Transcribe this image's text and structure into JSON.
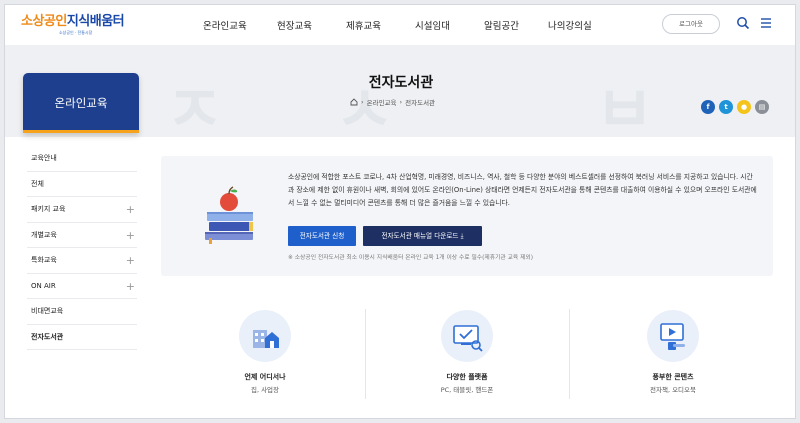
{
  "header": {
    "logo_primary": "소상공인",
    "logo_secondary": "지식배움터",
    "logo_tagline": "소상공인 · 전통시장",
    "nav": [
      "온라인교육",
      "현장교육",
      "제휴교육",
      "시설임대",
      "알림공간",
      "나의강의실"
    ],
    "login_label": "로그아웃"
  },
  "banner": {
    "title": "전자도서관",
    "breadcrumb": [
      "온라인교육",
      "전자도서관"
    ]
  },
  "sns": [
    {
      "icon": "facebook-icon",
      "glyph": "f",
      "color": "#1e63b8"
    },
    {
      "icon": "twitter-icon",
      "glyph": "t",
      "color": "#1f94d8"
    },
    {
      "icon": "kakao-story-icon",
      "glyph": "●",
      "color": "#f5c41a"
    },
    {
      "icon": "print-icon",
      "glyph": "▤",
      "color": "#8a8f98"
    }
  ],
  "sidebar": {
    "title": "온라인교육",
    "items": [
      {
        "label": "교육안내",
        "plus": false
      },
      {
        "label": "전체",
        "plus": false
      },
      {
        "label": "패키지 교육",
        "plus": true
      },
      {
        "label": "개별교육",
        "plus": true
      },
      {
        "label": "특화교육",
        "plus": true
      },
      {
        "label": "ON AIR",
        "plus": true
      },
      {
        "label": "비대면교육",
        "plus": false
      },
      {
        "label": "전자도서관",
        "plus": false
      }
    ]
  },
  "intro": {
    "text": "소상공인에 적합한 포스트 코로나, 4차 산업혁명, 미래경영, 비즈니스, 역사, 철학 등 다양한 분야의 베스트셀러를 선정하여 북러닝 서비스를 지공하고 있습니다. 시간과 장소에 제한 없이 휴원이나 새벽, 회의에 있어도 온라인(On-Line) 상태라면 언제든지 전자도서관을 통해 콘텐츠를 대출하여 이용하실 수 있으며 오프라인 도서관에서 느낄 수 없는 멀티미디어 콘텐츠를 통해 더 많은 즐거움을 느낄 수 있습니다.",
    "apply_button": "전자도서관 신청",
    "manual_button": "전자도서관 매뉴얼 다운로드",
    "note": "※ 소상공인 전자도서관 최소 이용시 지식배움터 온라인 교육 1개 이상 수료 필수(제휴기관 교육 제외)"
  },
  "features": [
    {
      "icon": "building-icon",
      "title": "언제 어디서나",
      "subtitle": "집, 사업장"
    },
    {
      "icon": "device-icon",
      "title": "다양한 플랫폼",
      "subtitle": "PC, 태블릿, 핸드폰"
    },
    {
      "icon": "media-icon",
      "title": "풍부한 콘텐츠",
      "subtitle": "전자책, 오디오북"
    }
  ]
}
